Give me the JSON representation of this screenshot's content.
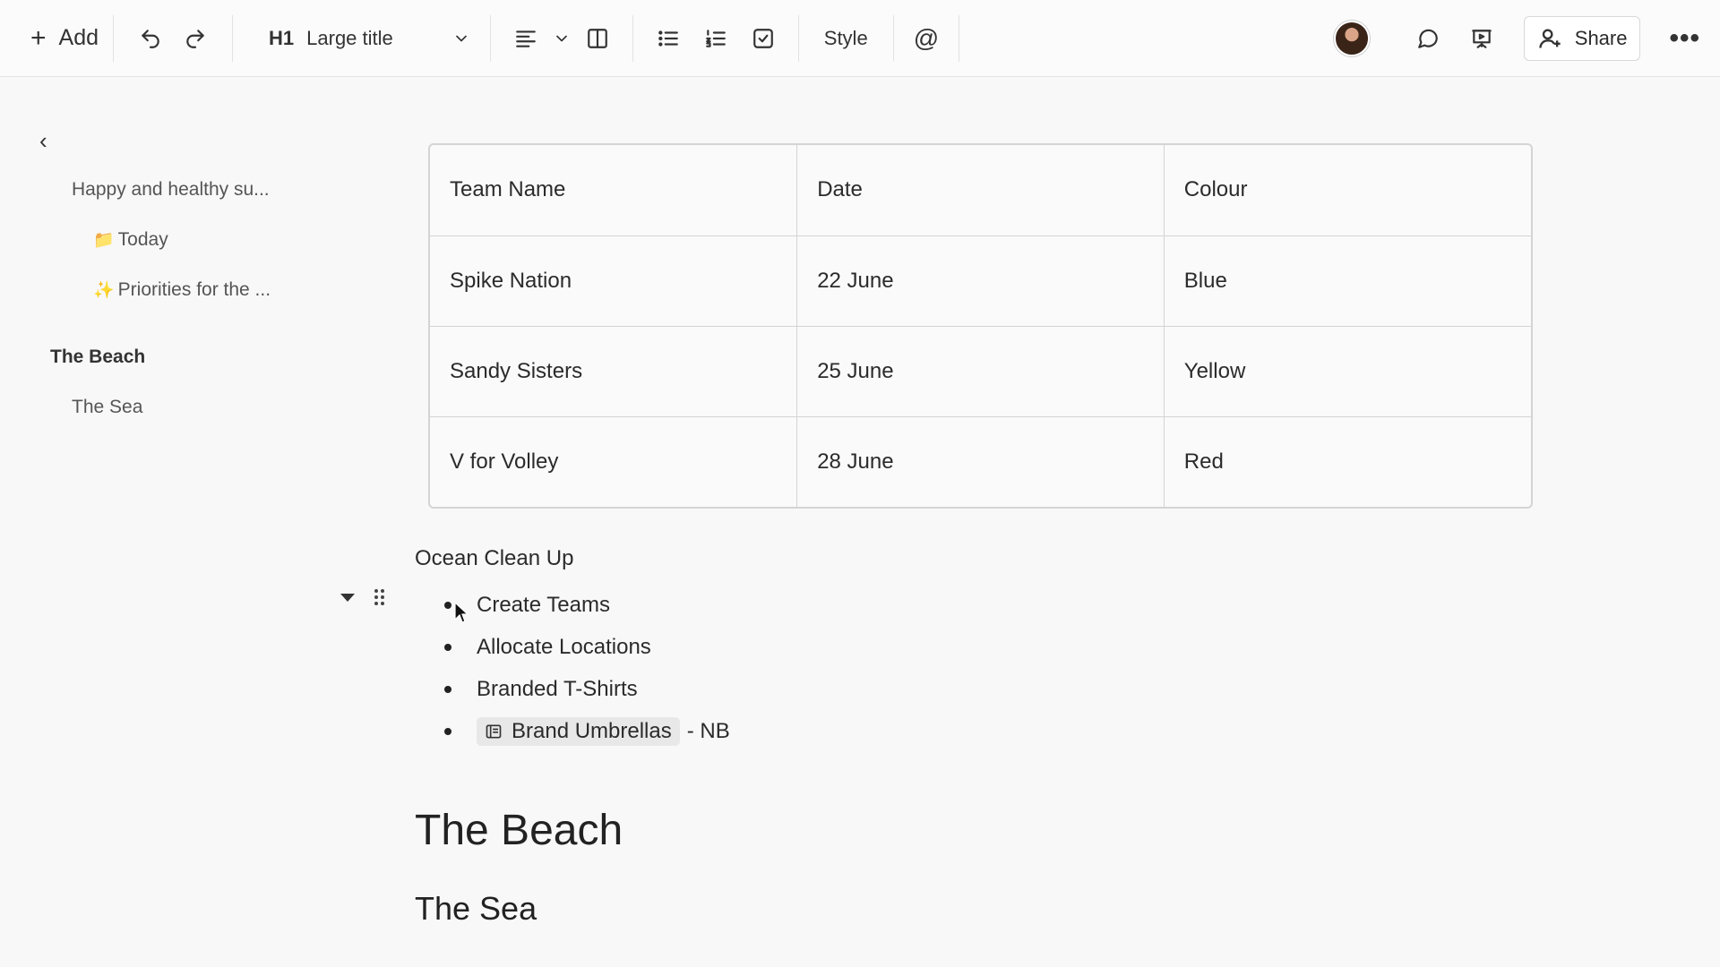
{
  "toolbar": {
    "add_label": "Add",
    "heading_prefix": "H1",
    "heading_style": "Large title",
    "style_label": "Style",
    "mention_symbol": "@",
    "share_label": "Share",
    "more_symbol": "•••",
    "icons": [
      "plus-icon",
      "undo-icon",
      "redo-icon",
      "chevron-down-icon",
      "align-left-icon",
      "columns-icon",
      "bullet-list-icon",
      "numbered-list-icon",
      "checkbox-icon",
      "mention-icon",
      "comment-icon",
      "present-icon",
      "add-person-icon",
      "more-icon"
    ]
  },
  "sidebar": {
    "collapse_symbol": "‹",
    "items": [
      {
        "label": "Happy and healthy su...",
        "emoji": ""
      },
      {
        "label": "Today",
        "emoji": "📁"
      },
      {
        "label": "Priorities for the ...",
        "emoji": "✨"
      },
      {
        "label": "The Beach",
        "emoji": ""
      },
      {
        "label": "The Sea",
        "emoji": ""
      }
    ]
  },
  "table": {
    "headers": [
      "Team Name",
      "Date",
      "Colour"
    ],
    "rows": [
      [
        "Spike Nation",
        "22 June",
        "Blue"
      ],
      [
        "Sandy Sisters",
        "25 June",
        "Yellow"
      ],
      [
        "V for Volley",
        "28 June",
        "Red"
      ]
    ]
  },
  "content": {
    "section_label": "Ocean Clean Up",
    "bullets": [
      "Create Teams",
      "Allocate Locations",
      "Branded T-Shirts"
    ],
    "chip_label": "Brand Umbrellas",
    "chip_suffix": "- NB",
    "heading_large": "The Beach",
    "heading_medium": "The Sea"
  }
}
